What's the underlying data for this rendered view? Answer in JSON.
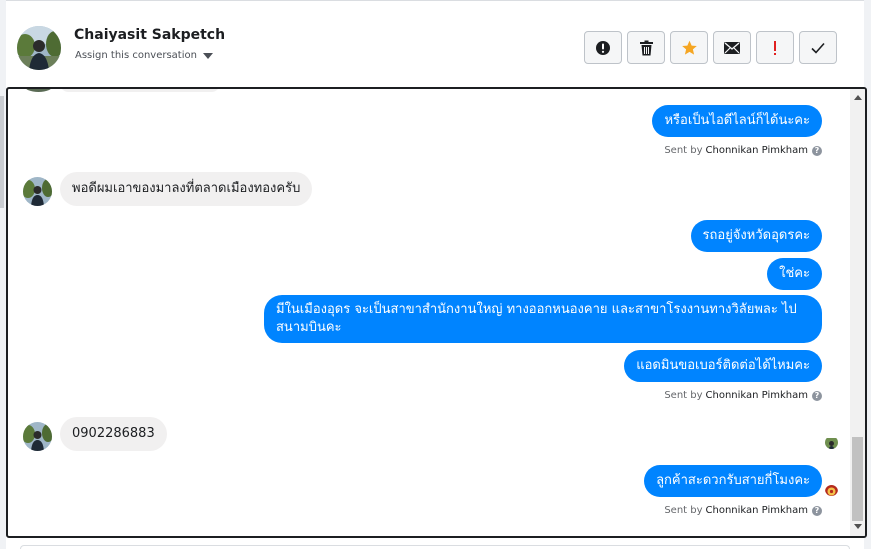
{
  "header": {
    "contact_name": "Chaiyasit Sakpetch",
    "assign_label": "Assign this conversation",
    "actions": [
      {
        "icon": "alert-circle-icon",
        "label": "Mark as spam"
      },
      {
        "icon": "trash-icon",
        "label": "Delete"
      },
      {
        "icon": "star-icon",
        "label": "Star"
      },
      {
        "icon": "envelope-icon",
        "label": "Mark as unread"
      },
      {
        "icon": "exclamation-icon",
        "label": "Follow up"
      },
      {
        "icon": "check-icon",
        "label": "Mark as done"
      }
    ],
    "colors": {
      "star": "#f5a623",
      "exclamation": "#e02020"
    }
  },
  "chat": {
    "messages": [
      {
        "dir": "out",
        "text": "หรือเป็นไอดีไลน์ก็ได้นะคะ"
      },
      {
        "dir": "in",
        "text": "พอดีผมเอาของมาลงที่ตลาดเมืองทองครับ"
      },
      {
        "dir": "out",
        "text": "รถอยู่จังหวัดอุดรคะ"
      },
      {
        "dir": "out",
        "text": "ใช่คะ"
      },
      {
        "dir": "out",
        "text": "มีในเมืองอุดร จะเป็นสาขาสำนักงานใหญ่ ทางออกหนองคาย และสาขาโรงงานทางวิลัยพละ ไปสนามบินคะ"
      },
      {
        "dir": "out",
        "text": "แอดมินขอเบอร์ติดต่อได้ไหมคะ"
      },
      {
        "dir": "in",
        "text": "0902286883"
      },
      {
        "dir": "out",
        "text": "ลูกค้าสะดวกรับสายกี่โมงคะ"
      }
    ],
    "sent_by_prefix": "Sent by",
    "sent_by_name": "Chonnikan Pimkham",
    "help_glyph": "?",
    "colors": {
      "outgoing_bubble": "#0084ff",
      "incoming_bubble": "#f1f0f0"
    }
  }
}
